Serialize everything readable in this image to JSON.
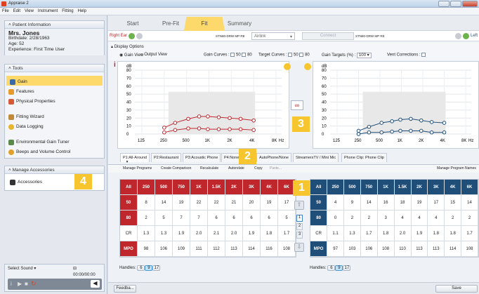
{
  "window": {
    "title": "Appraise 2"
  },
  "menu": [
    "File",
    "Edit",
    "View",
    "Instrument",
    "Fitting",
    "Help"
  ],
  "patient": {
    "header": "Patient Information",
    "name": "Mrs. Jones",
    "birthdate": "Birthdate: 2/28/1963",
    "age": "Age: 52",
    "experience": "Experience: First Time User"
  },
  "tools": {
    "header": "Tools",
    "items": [
      {
        "label": "Gain",
        "icon": "gain-icon",
        "selected": true
      },
      {
        "label": "Features",
        "icon": "features-icon"
      },
      {
        "label": "Physical Properties",
        "icon": "physical-properties-icon"
      },
      {
        "label": "Fitting Wizard",
        "icon": "fitting-wizard-icon"
      },
      {
        "label": "Data Logging",
        "icon": "data-logging-icon"
      },
      {
        "label": "Environmental Gain Tuner",
        "icon": "environmental-gain-tuner-icon"
      },
      {
        "label": "Beeps and Volume Control",
        "icon": "beeps-volume-icon"
      }
    ]
  },
  "accessories": {
    "header": "Manage Accessories",
    "item": "Accessories"
  },
  "sound": {
    "label": "Select Sound",
    "time": "00:00/00:00"
  },
  "badges": {
    "b1": "1",
    "b2": "2",
    "b3": "3",
    "b4": "4"
  },
  "nav_tabs": [
    "Start",
    "Pre-Fit",
    "Fit",
    "Summary"
  ],
  "devices": {
    "right": "Right Ear",
    "right_model": "STN80-DRW MP RE",
    "airlink": "Airlink",
    "connect": "Connect",
    "left_model": "STN80-DRW MP RE",
    "left": "Left"
  },
  "options": {
    "display": "Display Options",
    "gain_view": "Gain View",
    "output_view": "Output View",
    "gain_curves": "Gain Curves :",
    "curve50": "50",
    "curve80": "80",
    "target_curves": "Target Curves :",
    "gain_targets": "Gain Targets (%) :",
    "gain_targets_val": "100",
    "vent": "Vent Corrections :"
  },
  "graph": {
    "ylabel": "dB",
    "yticks": [
      "80",
      "70",
      "60",
      "50",
      "40",
      "30",
      "20",
      "10",
      "0"
    ],
    "xticks": [
      "125",
      "250",
      "500",
      "1K",
      "2K",
      "4K",
      "8K"
    ],
    "xunit": "Hz"
  },
  "program_tabs": [
    "P1:All-Around",
    "P2:Restaurant",
    "P3:Acoustic Phone",
    "P4:None",
    "AutoPhone/None",
    "StreamersTV / Mini Mic",
    "Phone Clip: Phone Clip"
  ],
  "program_actions": [
    "Manage Programs",
    "Create Comparison",
    "Recalculate",
    "Autorelate",
    "Copy",
    "Paste...",
    "Manage Program Names"
  ],
  "columns": [
    "All",
    "250",
    "500",
    "750",
    "1K",
    "1.5K",
    "2K",
    "3K",
    "4K",
    "6K"
  ],
  "right_table": {
    "rows": [
      {
        "label": "50",
        "values": [
          "8",
          "14",
          "19",
          "22",
          "22",
          "21",
          "20",
          "19",
          "17"
        ]
      },
      {
        "label": "80",
        "values": [
          "2",
          "5",
          "7",
          "7",
          "6",
          "6",
          "6",
          "6",
          "5"
        ]
      },
      {
        "label": "CR",
        "values": [
          "1.3",
          "1.3",
          "1.9",
          "2.0",
          "2.1",
          "2.0",
          "1.9",
          "1.8",
          "1.7"
        ]
      },
      {
        "label": "MPO",
        "values": [
          "98",
          "106",
          "109",
          "111",
          "112",
          "113",
          "114",
          "116",
          "108"
        ]
      }
    ]
  },
  "left_table": {
    "rows": [
      {
        "label": "50",
        "values": [
          "4",
          "9",
          "14",
          "16",
          "18",
          "19",
          "17",
          "15",
          "14"
        ]
      },
      {
        "label": "80",
        "values": [
          "0",
          "2",
          "2",
          "3",
          "4",
          "4",
          "4",
          "2",
          "2"
        ]
      },
      {
        "label": "CR",
        "values": [
          "1.1",
          "1.3",
          "1.7",
          "1.8",
          "2.0",
          "1.9",
          "1.8",
          "1.8",
          "1.7"
        ]
      },
      {
        "label": "MPO",
        "values": [
          "97",
          "103",
          "106",
          "108",
          "110",
          "113",
          "113",
          "114",
          "108"
        ]
      }
    ]
  },
  "handles": {
    "label": "Handles:",
    "options": [
      "6",
      "9",
      "17"
    ],
    "selected": "9"
  },
  "pager": [
    "1",
    "2",
    "3"
  ],
  "footer": {
    "feedback": "Feedba...",
    "save": "Save"
  },
  "colors": {
    "right": "#c0272d",
    "left": "#1f4e79",
    "accent": "#fdd86a",
    "badge": "#f7c62f"
  }
}
